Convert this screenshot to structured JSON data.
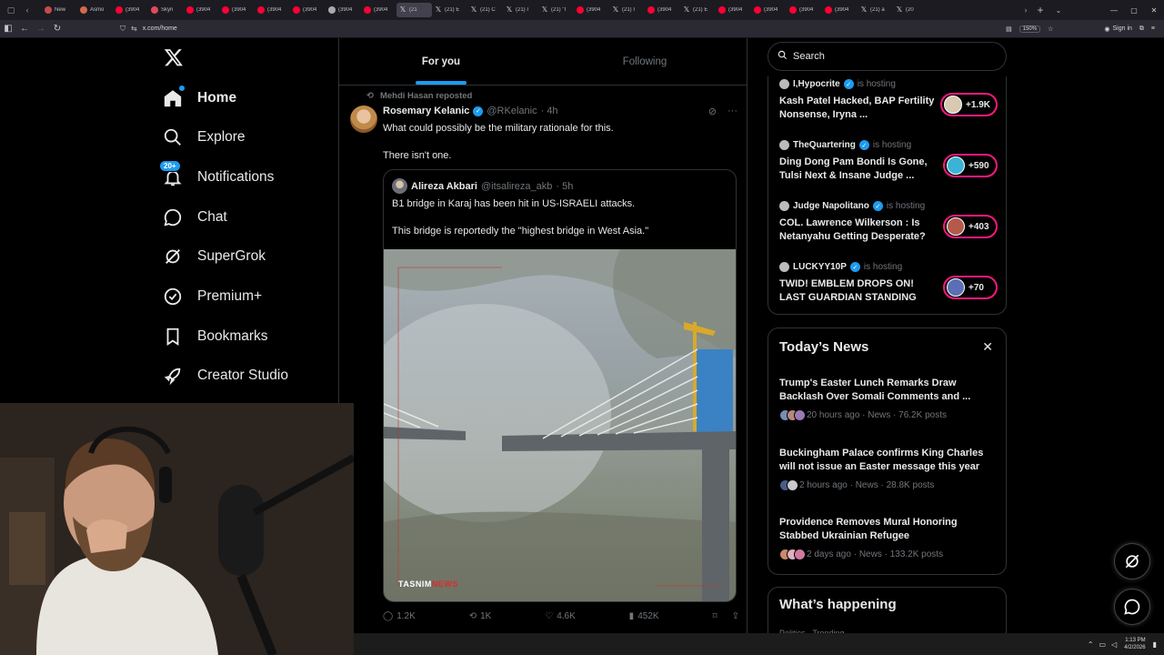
{
  "browser": {
    "tabs": [
      {
        "title": "New",
        "fav": "#c94a4a"
      },
      {
        "title": "Asmo",
        "fav": "#d26b4b"
      },
      {
        "title": "(3904",
        "fav": "#ff0033"
      },
      {
        "title": "Skyri",
        "fav": "#e04a5a"
      },
      {
        "title": "(3904",
        "fav": "#ff0033"
      },
      {
        "title": "(3904",
        "fav": "#ff0033"
      },
      {
        "title": "(3904",
        "fav": "#ff0033"
      },
      {
        "title": "(3904",
        "fav": "#ff0033"
      },
      {
        "title": "(3904",
        "fav": "#aaaaaa"
      },
      {
        "title": "(3904",
        "fav": "#ff0033"
      },
      {
        "title": "(21",
        "fav": "x",
        "active": true
      },
      {
        "title": "(21) E",
        "fav": "x"
      },
      {
        "title": "(21) C",
        "fav": "x"
      },
      {
        "title": "(21) I",
        "fav": "x"
      },
      {
        "title": "(21) \"I",
        "fav": "x"
      },
      {
        "title": "(3904",
        "fav": "#ff0033"
      },
      {
        "title": "(21) I",
        "fav": "x"
      },
      {
        "title": "(3904",
        "fav": "#ff0033"
      },
      {
        "title": "(21) E",
        "fav": "x"
      },
      {
        "title": "(3904",
        "fav": "#ff0033"
      },
      {
        "title": "(3904",
        "fav": "#ff0033"
      },
      {
        "title": "(3904",
        "fav": "#ff0033"
      },
      {
        "title": "(3904",
        "fav": "#ff0033"
      },
      {
        "title": "(21) a",
        "fav": "x"
      },
      {
        "title": "(20",
        "fav": "x"
      }
    ],
    "url": "x.com/home",
    "zoom": "150%",
    "sign_in": "Sign in"
  },
  "nav": {
    "items": [
      {
        "label": "Home",
        "icon": "home-icon",
        "bold": true
      },
      {
        "label": "Explore",
        "icon": "search-icon"
      },
      {
        "label": "Notifications",
        "icon": "bell-icon",
        "badge": "20+"
      },
      {
        "label": "Chat",
        "icon": "chat-icon"
      },
      {
        "label": "SuperGrok",
        "icon": "grok-icon"
      },
      {
        "label": "Premium+",
        "icon": "premium-icon"
      },
      {
        "label": "Bookmarks",
        "icon": "bookmark-icon"
      },
      {
        "label": "Creator Studio",
        "icon": "rocket-icon"
      }
    ]
  },
  "feed": {
    "tabs": [
      {
        "label": "For you",
        "active": true
      },
      {
        "label": "Following"
      }
    ],
    "tweet": {
      "reposted_by": "Mehdi Hasan reposted",
      "name": "Rosemary Kelanic",
      "handle": "@RKelanic",
      "time": "· 4h",
      "text1": "What could possibly be the military rationale for this.",
      "text2": "There isn't one.",
      "quote": {
        "name": "Alireza Akbari",
        "handle": "@itsalireza_akb",
        "time": "· 5h",
        "text1": "B1 bridge in Karaj has been hit in US-ISRAELI attacks.",
        "text2": "This bridge is reportedly the \"highest bridge in West Asia.\"",
        "watermark_a": "TASNIM",
        "watermark_b": "NEWS"
      },
      "stats": {
        "replies": "1.2K",
        "reposts": "1K",
        "likes": "4.6K",
        "views": "452K"
      }
    }
  },
  "right": {
    "search_placeholder": "Search",
    "spaces": [
      {
        "host": "I,Hypocrite",
        "hosting": "is hosting",
        "verified": true,
        "title": "Kash Patel Hacked, BAP Fertility Nonsense, Iryna ...",
        "count": "+1.9K",
        "avatar": "#d9c9b0"
      },
      {
        "host": "TheQuartering",
        "hosting": "is hosting",
        "verified": true,
        "title": "Ding Dong Pam Bondi Is Gone, Tulsi Next & Insane Judge ...",
        "count": "+590",
        "avatar": "#3bb3d6"
      },
      {
        "host": "Judge Napolitano",
        "hosting": "is hosting",
        "verified": true,
        "title": "COL. Lawrence Wilkerson : Is Netanyahu Getting Desperate?",
        "count": "+403",
        "avatar": "#b55a4a"
      },
      {
        "host": "LUCKYY10P",
        "hosting": "is hosting",
        "verified": true,
        "title": "TWID! EMBLEM DROPS ON! LAST GUARDIAN STANDING",
        "count": "+70",
        "avatar": "#5a6fb5"
      }
    ],
    "news": {
      "title": "Today’s News",
      "items": [
        {
          "title": "Trump's Easter Lunch Remarks Draw Backlash Over Somali Comments and ...",
          "meta": "20 hours ago · News · 76.2K posts"
        },
        {
          "title": "Buckingham Palace confirms King Charles will not issue an Easter message this year",
          "meta": "2 hours ago · News · 28.8K posts"
        },
        {
          "title": "Providence Removes Mural Honoring Stabbed Ukrainian Refugee",
          "meta": "2 days ago · News · 133.2K posts"
        }
      ]
    },
    "happening": {
      "title": "What’s happening",
      "sub": "Politics · Trending"
    }
  },
  "taskbar": {
    "time": "1:13 PM",
    "date": "4/2/2026"
  }
}
